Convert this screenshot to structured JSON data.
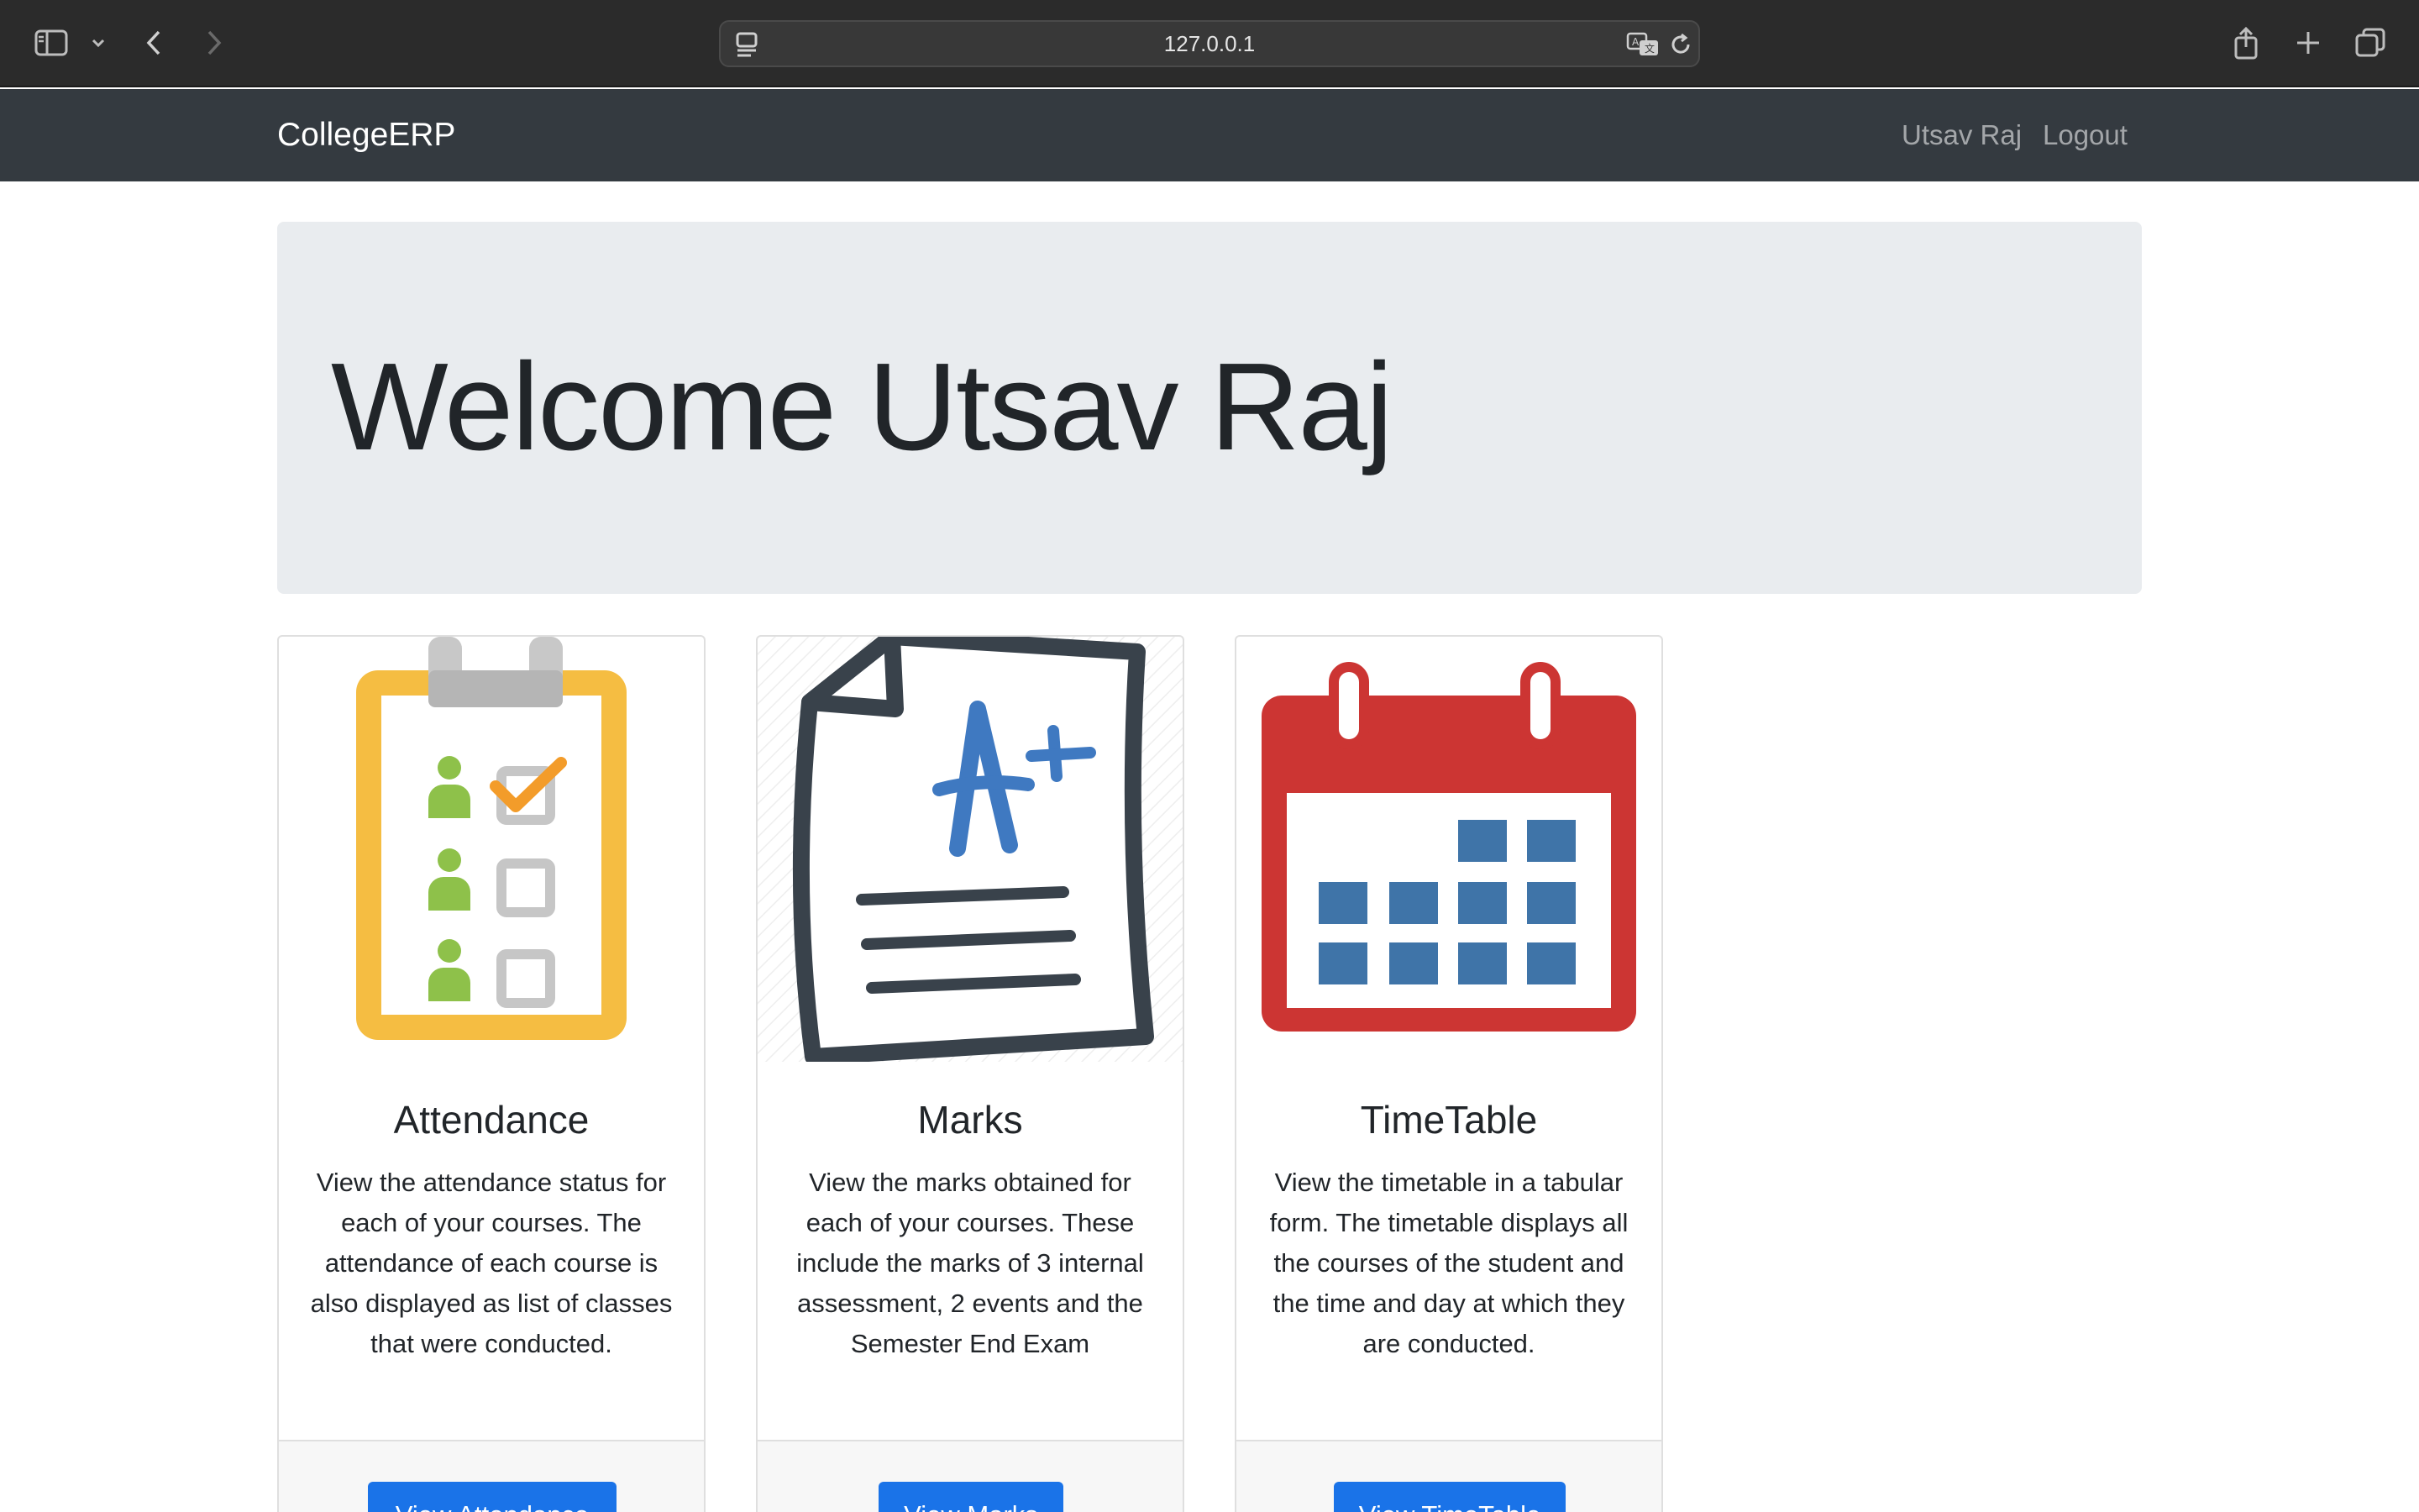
{
  "browser": {
    "url": "127.0.0.1"
  },
  "navbar": {
    "brand": "CollegeERP",
    "user_link": "Utsav Raj",
    "logout_link": "Logout"
  },
  "jumbotron": {
    "heading": "Welcome Utsav Raj"
  },
  "cards": [
    {
      "title": "Attendance",
      "text": "View the attendance status for each of your courses. The attendance of each course is also displayed as list of classes that were conducted.",
      "button": "View Attendance",
      "icon": "attendance-clipboard-icon"
    },
    {
      "title": "Marks",
      "text": "View the marks obtained for each of your courses. These include the marks of 3 internal assessment, 2 events and the Semester End Exam",
      "button": "View Marks",
      "icon": "marks-paper-icon"
    },
    {
      "title": "TimeTable",
      "text": "View the timetable in a tabular form. The timetable displays all the courses of the student and the time and day at which they are conducted.",
      "button": "View TimeTable",
      "icon": "calendar-icon"
    }
  ],
  "colors": {
    "navbar_bg": "#343a40",
    "jumbotron_bg": "#e9ecef",
    "button_bg": "#1a73e8"
  }
}
